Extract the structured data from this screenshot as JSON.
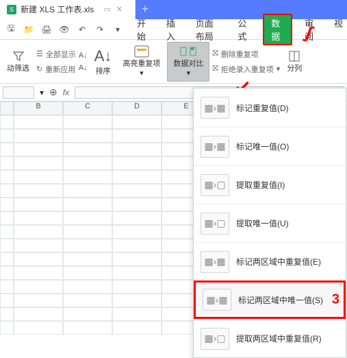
{
  "titlebar": {
    "file_type_letter": "S",
    "filename": "新建 XLS 工作表.xls",
    "plus": "+"
  },
  "menubar": {
    "tabs": [
      "开始",
      "插入",
      "页面布局",
      "公式",
      "数据",
      "审阅",
      "视"
    ],
    "selected_index": 4
  },
  "ribbon": {
    "filter_group": {
      "label1": "动筛选",
      "label2_top": "全部显示",
      "label2_bot": "重新应用"
    },
    "sort_group": {
      "top": "A↓",
      "bot": "排序",
      "side_top": "A↓",
      "side_bot": "A↓"
    },
    "highlight_group": {
      "label": "高亮重复项"
    },
    "compare_group": {
      "label": "数据对比"
    },
    "right_group": {
      "top": "删除重复项",
      "bot": "拒绝录入重复项"
    },
    "split_group": {
      "label": "分列"
    }
  },
  "fxbar": {
    "zoom_icon": "⊕",
    "fx_label": "fx"
  },
  "cols": [
    "B",
    "C",
    "D",
    "E"
  ],
  "dropdown": {
    "items": [
      {
        "label": "标记重复值(D)"
      },
      {
        "label": "标记唯一值(O)"
      },
      {
        "label": "提取重复值(I)"
      },
      {
        "label": "提取唯一值(U)"
      },
      {
        "label": "标记两区域中重复值(E)"
      },
      {
        "label": "标记两区域中唯一值(S)",
        "highlight": true
      },
      {
        "label": "提取两区域中重复值(R)"
      }
    ]
  },
  "annotations": {
    "scribble1": "∫",
    "scribble2": "↙",
    "scribble3": "3"
  }
}
